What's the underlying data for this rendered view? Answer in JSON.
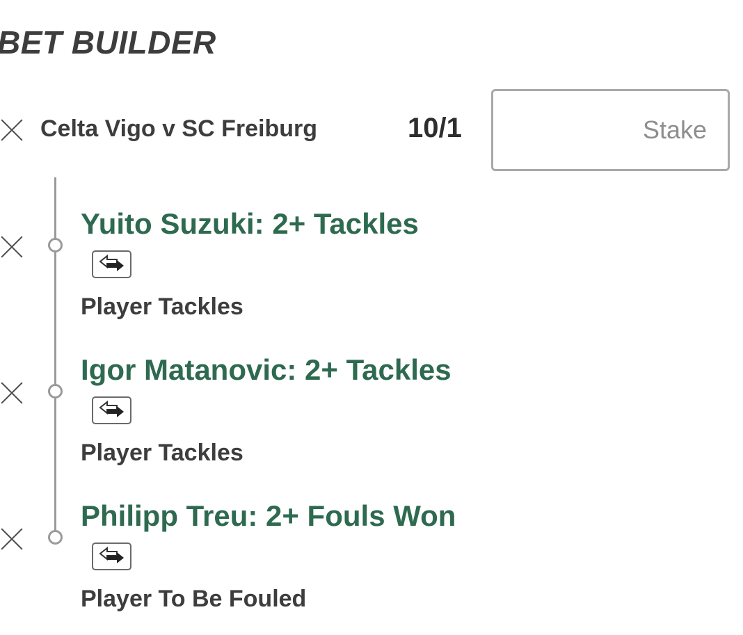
{
  "header": {
    "title": "BET BUILDER"
  },
  "event": {
    "name": "Celta Vigo v SC Freiburg",
    "odds": "10/1",
    "stake_placeholder": "Stake"
  },
  "selections": [
    {
      "title": "Yuito Suzuki: 2+ Tackles",
      "market": "Player Tackles"
    },
    {
      "title": "Igor Matanovic: 2+ Tackles",
      "market": "Player Tackles"
    },
    {
      "title": "Philipp Treu: 2+ Fouls Won",
      "market": "Player To Be Fouled"
    }
  ],
  "colors": {
    "selection_title": "#2e6a4f",
    "text_dark": "#3d3d3d"
  },
  "icons": [
    "close-icon",
    "swap-icon"
  ]
}
